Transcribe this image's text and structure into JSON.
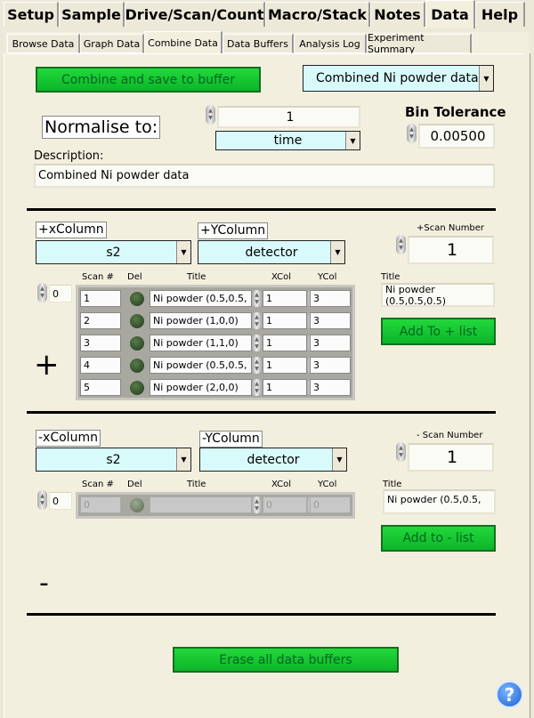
{
  "tabs": [
    "Setup",
    "Sample",
    "Drive/Scan/Count",
    "Macro/Stack",
    "Notes",
    "Data",
    "Help"
  ],
  "active_tab": "Data",
  "subtabs": [
    "Browse Data",
    "Graph Data",
    "Combine Data",
    "Data Buffers",
    "Analysis Log",
    "Experiment Summary"
  ],
  "active_subtab": "Combine Data",
  "combine_button": "Combine and save to buffer",
  "buffer_select": "Combined Ni powder data",
  "normalise_label": "Normalise to:",
  "normalise_value": "1",
  "normalise_unit": "time",
  "bin_tolerance_label": "Bin Tolerance",
  "bin_tolerance": "0.00500",
  "description_label": "Description:",
  "description": "Combined Ni powder data",
  "plus": {
    "sign": "+",
    "xcol_label": "+xColumn",
    "xcol": "s2",
    "ycol_label": "+YColumn",
    "ycol": "detector",
    "scan_label": "+Scan Number",
    "scan": "1",
    "title_label": "Title",
    "title": "Ni powder (0.5,0.5,0.5)",
    "add_button": "Add To + list",
    "index": "0",
    "headers": [
      "Scan #",
      "Del",
      "Title",
      "XCol",
      "YCol"
    ],
    "rows": [
      {
        "scan": "1",
        "title": "Ni powder (0.5,0.5,",
        "x": "1",
        "y": "3"
      },
      {
        "scan": "2",
        "title": "Ni powder (1,0,0)",
        "x": "1",
        "y": "3"
      },
      {
        "scan": "3",
        "title": "Ni powder (1,1,0)",
        "x": "1",
        "y": "3"
      },
      {
        "scan": "4",
        "title": "Ni powder (0.5,0.5,",
        "x": "1",
        "y": "3"
      },
      {
        "scan": "5",
        "title": "Ni powder (2,0,0)",
        "x": "1",
        "y": "3"
      }
    ]
  },
  "minus": {
    "sign": "-",
    "xcol_label": "-xColumn",
    "xcol": "s2",
    "ycol_label": "-YColumn",
    "ycol": "detector",
    "scan_label": "- Scan Number",
    "scan": "1",
    "title_label": "Title",
    "title": "Ni powder (0.5,0.5,",
    "add_button": "Add to - list",
    "index": "0",
    "headers": [
      "Scan #",
      "Del",
      "Title",
      "XCol",
      "YCol"
    ],
    "rows": [
      {
        "scan": "0",
        "title": "",
        "x": "0",
        "y": "0"
      }
    ]
  },
  "erase_button": "Erase all data buffers",
  "help_icon": "question-mark-icon",
  "colors": {
    "button_green": "#17c830",
    "ring_bg": "#d8fafa",
    "panel_bg": "#f3efdf"
  }
}
